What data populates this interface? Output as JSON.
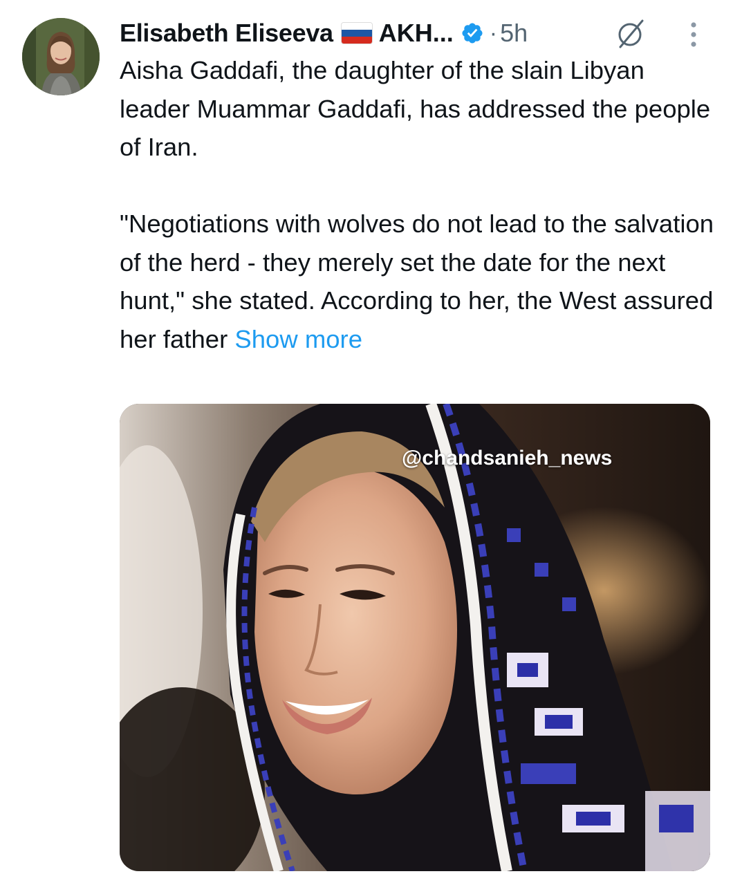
{
  "post": {
    "author": {
      "name": "Elisabeth Eliseeva",
      "flag_icon": "russia-flag-icon",
      "handle": "AKH...",
      "verified_icon": "verified-badge-icon",
      "separator": "·",
      "time": "5h"
    },
    "actions": {
      "grok_icon": "grok-slash-icon",
      "more_icon": "more-options-icon"
    },
    "body": {
      "paragraph_1": "Aisha Gaddafi, the daughter of the slain Libyan leader Muammar Gaddafi, has addressed the people of Iran.",
      "paragraph_2": "\"Negotiations with wolves do not lead to the salvation of the herd - they merely set the date for the next hunt,\" she stated. According to her, the West assured her father",
      "show_more": "Show more"
    },
    "media": {
      "watermark": "@chandsanieh_news"
    }
  },
  "colors": {
    "text": "#0f1419",
    "secondary": "#536471",
    "link": "#1d9bf0"
  }
}
